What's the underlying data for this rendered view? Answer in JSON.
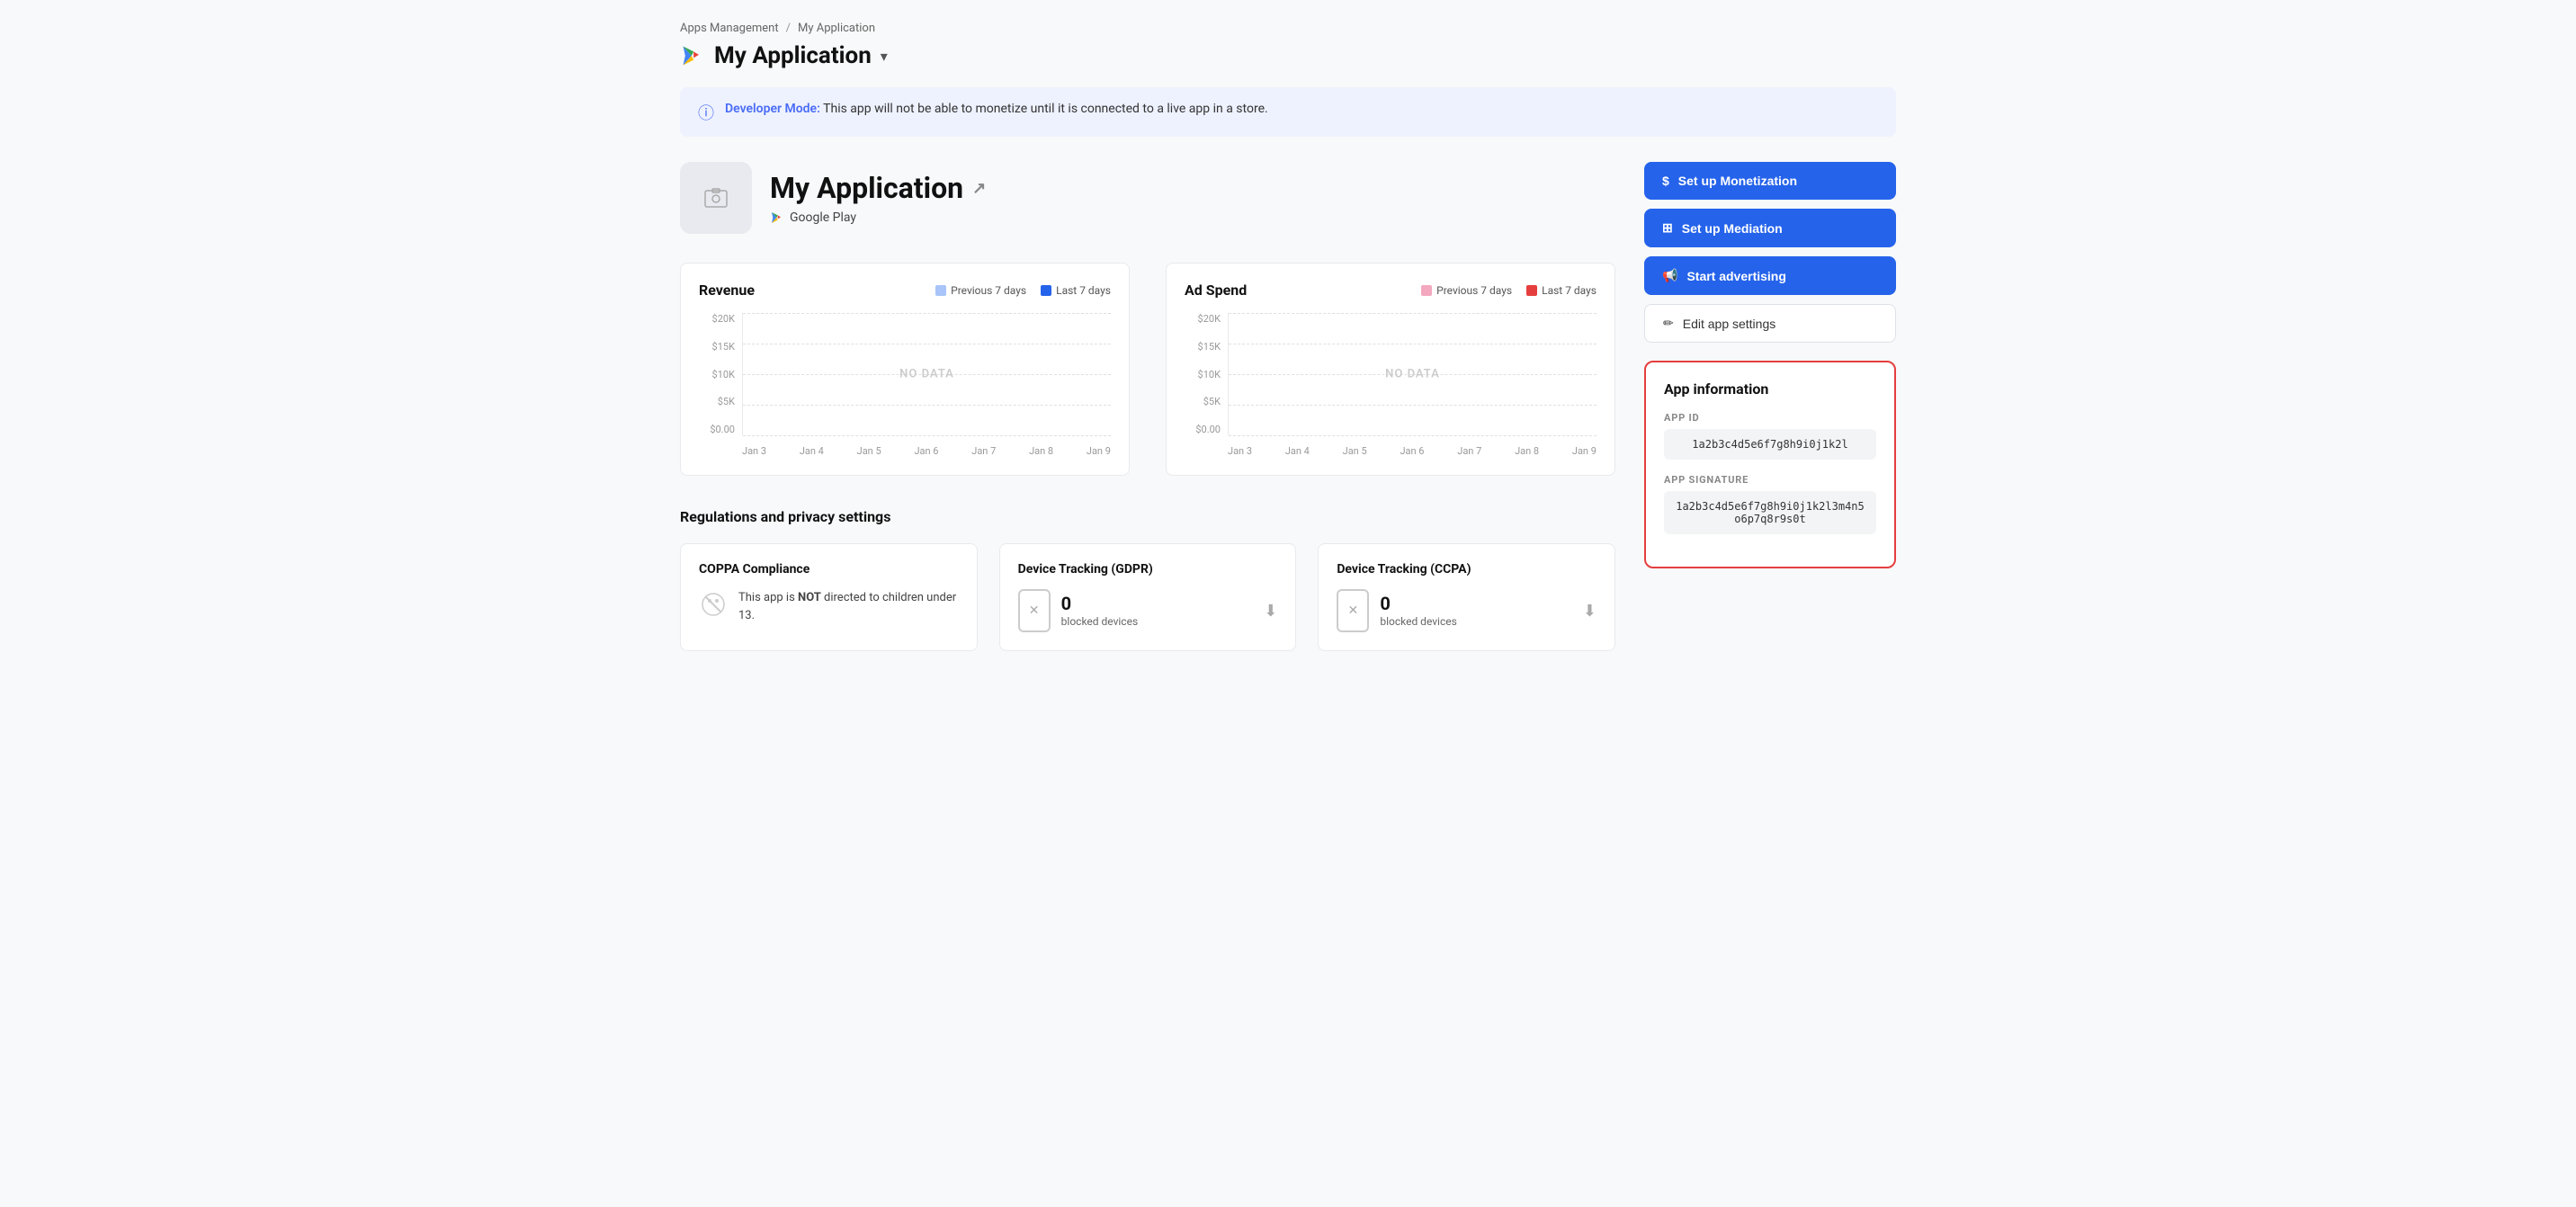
{
  "breadcrumb": {
    "parent": "Apps Management",
    "separator": "/",
    "current": "My Application"
  },
  "header": {
    "app_name": "My Application",
    "dropdown_arrow": "▾"
  },
  "banner": {
    "label": "Developer Mode:",
    "text": "This app will not be able to monetize until it is connected to a live app in a store."
  },
  "app_info": {
    "name": "My Application",
    "store": "Google Play"
  },
  "revenue_chart": {
    "title": "Revenue",
    "legend": [
      {
        "label": "Previous 7 days",
        "color": "#a8c4f8"
      },
      {
        "label": "Last 7 days",
        "color": "#2563eb"
      }
    ],
    "y_labels": [
      "$20K",
      "$15K",
      "$10K",
      "$5K",
      "$0.00"
    ],
    "x_labels": [
      "Jan 3",
      "Jan 4",
      "Jan 5",
      "Jan 6",
      "Jan 7",
      "Jan 8",
      "Jan 9"
    ],
    "no_data": "NO DATA"
  },
  "adspend_chart": {
    "title": "Ad Spend",
    "legend": [
      {
        "label": "Previous 7 days",
        "color": "#f4a8c0"
      },
      {
        "label": "Last 7 days",
        "color": "#e53e3e"
      }
    ],
    "y_labels": [
      "$20K",
      "$15K",
      "$10K",
      "$5K",
      "$0.00"
    ],
    "x_labels": [
      "Jan 3",
      "Jan 4",
      "Jan 5",
      "Jan 6",
      "Jan 7",
      "Jan 8",
      "Jan 9"
    ],
    "no_data": "NO DATA"
  },
  "buttons": {
    "monetization": "Set up Monetization",
    "mediation": "Set up Mediation",
    "advertising": "Start advertising",
    "edit_settings": "Edit app settings"
  },
  "app_information": {
    "title": "App information",
    "app_id_label": "APP ID",
    "app_id_value": "1a2b3c4d5e6f7g8h9i0j1k2l",
    "app_signature_label": "APP SIGNATURE",
    "app_signature_value": "1a2b3c4d5e6f7g8h9i0j1k2l3m4n5o6p7q8r9s0t"
  },
  "regulations": {
    "section_title": "Regulations and privacy settings",
    "coppa": {
      "title": "COPPA Compliance",
      "text": "This app is NOT directed to children under 13."
    },
    "gdpr": {
      "title": "Device Tracking (GDPR)",
      "count": "0",
      "label": "blocked devices"
    },
    "ccpa": {
      "title": "Device Tracking (CCPA)",
      "count": "0",
      "label": "blocked devices"
    }
  }
}
